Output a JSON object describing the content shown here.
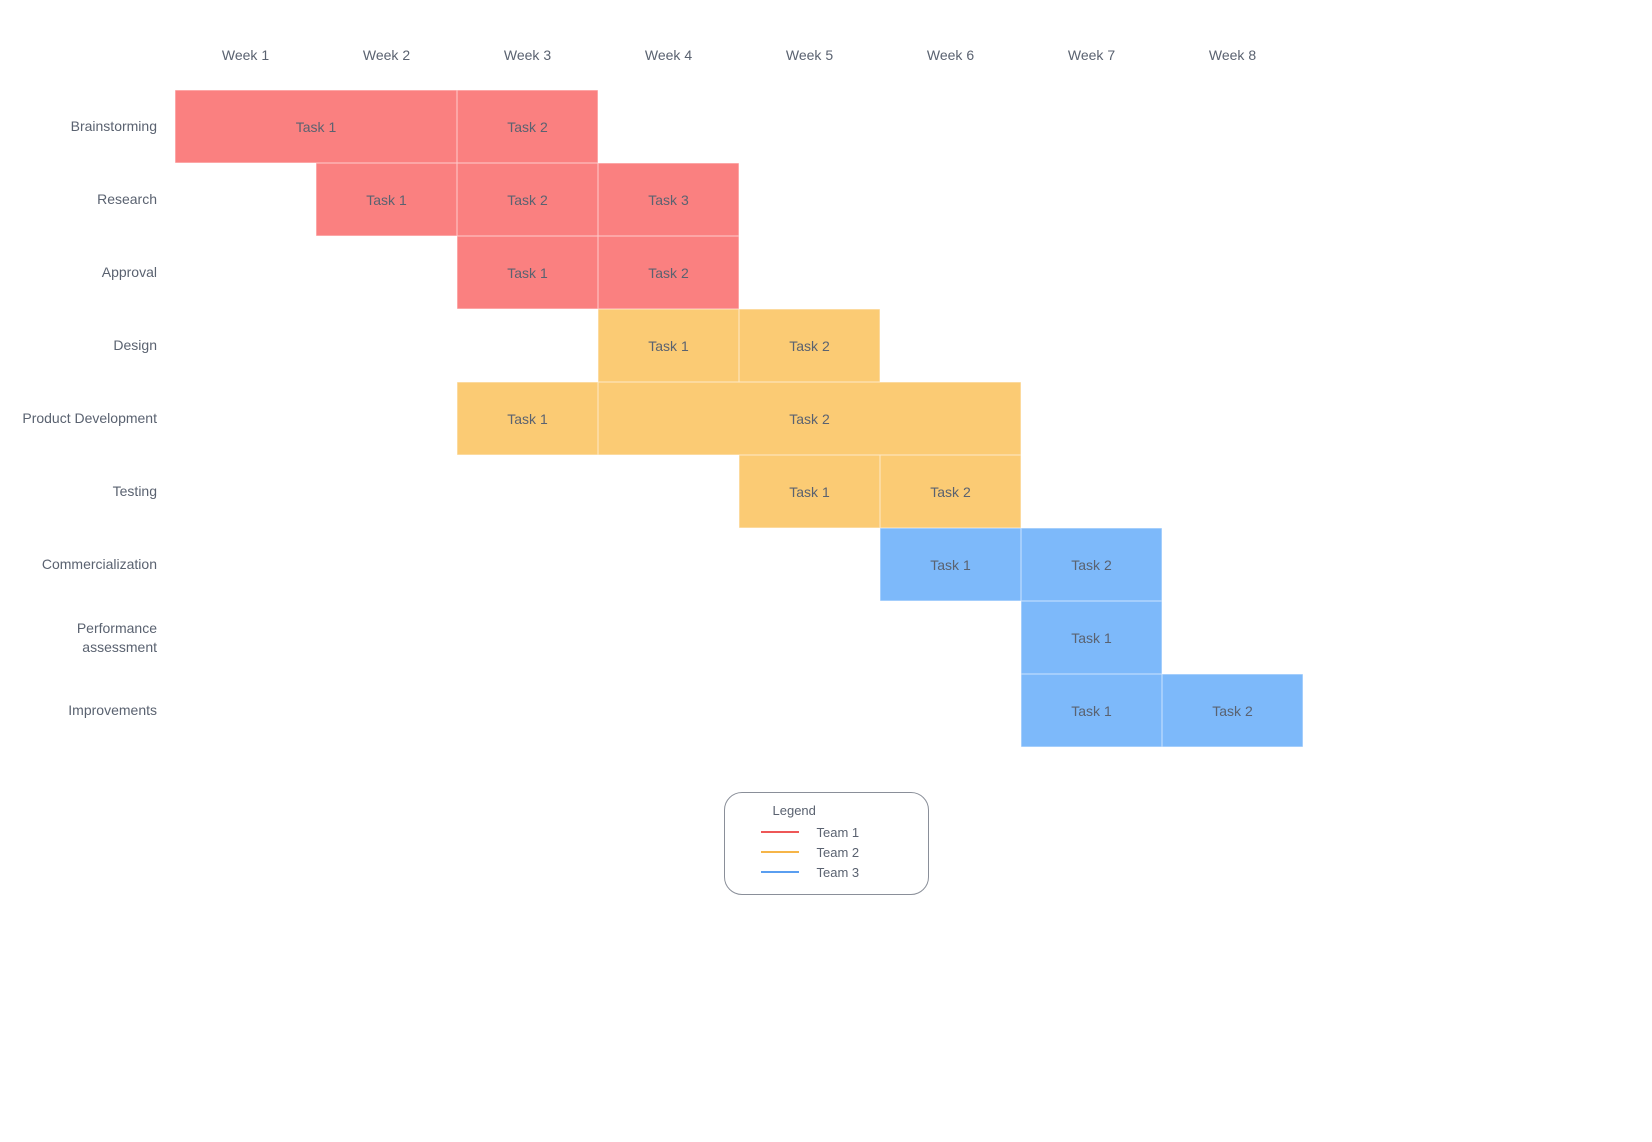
{
  "columns": [
    "Week 1",
    "Week 2",
    "Week 3",
    "Week 4",
    "Week 5",
    "Week 6",
    "Week  7",
    "Week 8"
  ],
  "rows": [
    {
      "label": "Brainstorming",
      "bars": [
        {
          "label": "Task 1",
          "team": 1,
          "start": 1,
          "span": 2
        },
        {
          "label": "Task 2",
          "team": 1,
          "start": 3,
          "span": 1
        }
      ]
    },
    {
      "label": "Research",
      "bars": [
        {
          "label": "Task 1",
          "team": 1,
          "start": 2,
          "span": 1
        },
        {
          "label": "Task 2",
          "team": 1,
          "start": 3,
          "span": 1
        },
        {
          "label": "Task 3",
          "team": 1,
          "start": 4,
          "span": 1
        }
      ]
    },
    {
      "label": "Approval",
      "bars": [
        {
          "label": "Task 1",
          "team": 1,
          "start": 3,
          "span": 1
        },
        {
          "label": "Task 2",
          "team": 1,
          "start": 4,
          "span": 1
        }
      ]
    },
    {
      "label": "Design",
      "bars": [
        {
          "label": "Task 1",
          "team": 2,
          "start": 4,
          "span": 1
        },
        {
          "label": "Task 2",
          "team": 2,
          "start": 5,
          "span": 1
        }
      ]
    },
    {
      "label": "Product Development",
      "bars": [
        {
          "label": "Task 1",
          "team": 2,
          "start": 3,
          "span": 1
        },
        {
          "label": "Task 2",
          "team": 2,
          "start": 4,
          "span": 3
        }
      ]
    },
    {
      "label": "Testing",
      "bars": [
        {
          "label": "Task 1",
          "team": 2,
          "start": 5,
          "span": 1
        },
        {
          "label": "Task 2",
          "team": 2,
          "start": 6,
          "span": 1
        }
      ]
    },
    {
      "label": "Commercialization",
      "bars": [
        {
          "label": "Task 1",
          "team": 3,
          "start": 6,
          "span": 1
        },
        {
          "label": "Task 2",
          "team": 3,
          "start": 7,
          "span": 1
        }
      ]
    },
    {
      "label": "Performance assessment",
      "bars": [
        {
          "label": "Task 1",
          "team": 3,
          "start": 7,
          "span": 1
        }
      ]
    },
    {
      "label": "Improvements",
      "bars": [
        {
          "label": "Task 1",
          "team": 3,
          "start": 7,
          "span": 1
        },
        {
          "label": "Task 2",
          "team": 3,
          "start": 8,
          "span": 1
        }
      ]
    }
  ],
  "legend": {
    "title": "Legend",
    "items": [
      {
        "label": "Team 1",
        "colorClass": "red"
      },
      {
        "label": "Team 2",
        "colorClass": "orange"
      },
      {
        "label": "Team 3",
        "colorClass": "blue"
      }
    ]
  },
  "colors": {
    "team1": "#fa8080",
    "team2": "#fbcb74",
    "team3": "#7db9fa"
  },
  "chart_data": {
    "type": "gantt",
    "title": "",
    "x_unit": "week",
    "x_categories": [
      "Week 1",
      "Week 2",
      "Week 3",
      "Week 4",
      "Week 5",
      "Week 6",
      "Week 7",
      "Week 8"
    ],
    "rows": [
      {
        "category": "Brainstorming",
        "tasks": [
          {
            "name": "Task 1",
            "team": "Team 1",
            "start": 1,
            "duration": 2
          },
          {
            "name": "Task 2",
            "team": "Team 1",
            "start": 3,
            "duration": 1
          }
        ]
      },
      {
        "category": "Research",
        "tasks": [
          {
            "name": "Task 1",
            "team": "Team 1",
            "start": 2,
            "duration": 1
          },
          {
            "name": "Task 2",
            "team": "Team 1",
            "start": 3,
            "duration": 1
          },
          {
            "name": "Task 3",
            "team": "Team 1",
            "start": 4,
            "duration": 1
          }
        ]
      },
      {
        "category": "Approval",
        "tasks": [
          {
            "name": "Task 1",
            "team": "Team 1",
            "start": 3,
            "duration": 1
          },
          {
            "name": "Task 2",
            "team": "Team 1",
            "start": 4,
            "duration": 1
          }
        ]
      },
      {
        "category": "Design",
        "tasks": [
          {
            "name": "Task 1",
            "team": "Team 2",
            "start": 4,
            "duration": 1
          },
          {
            "name": "Task 2",
            "team": "Team 2",
            "start": 5,
            "duration": 1
          }
        ]
      },
      {
        "category": "Product Development",
        "tasks": [
          {
            "name": "Task 1",
            "team": "Team 2",
            "start": 3,
            "duration": 1
          },
          {
            "name": "Task 2",
            "team": "Team 2",
            "start": 4,
            "duration": 3
          }
        ]
      },
      {
        "category": "Testing",
        "tasks": [
          {
            "name": "Task 1",
            "team": "Team 2",
            "start": 5,
            "duration": 1
          },
          {
            "name": "Task 2",
            "team": "Team 2",
            "start": 6,
            "duration": 1
          }
        ]
      },
      {
        "category": "Commercialization",
        "tasks": [
          {
            "name": "Task 1",
            "team": "Team 3",
            "start": 6,
            "duration": 1
          },
          {
            "name": "Task 2",
            "team": "Team 3",
            "start": 7,
            "duration": 1
          }
        ]
      },
      {
        "category": "Performance assessment",
        "tasks": [
          {
            "name": "Task 1",
            "team": "Team 3",
            "start": 7,
            "duration": 1
          }
        ]
      },
      {
        "category": "Improvements",
        "tasks": [
          {
            "name": "Task 1",
            "team": "Team 3",
            "start": 7,
            "duration": 1
          },
          {
            "name": "Task 2",
            "team": "Team 3",
            "start": 8,
            "duration": 1
          }
        ]
      }
    ],
    "legend": [
      "Team 1",
      "Team 2",
      "Team 3"
    ],
    "legend_colors": {
      "Team 1": "#fa8080",
      "Team 2": "#fbcb74",
      "Team 3": "#7db9fa"
    }
  }
}
